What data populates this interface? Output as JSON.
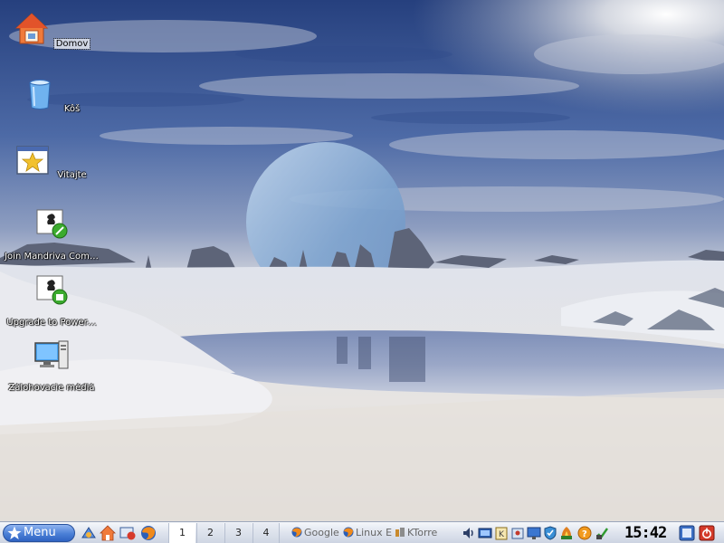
{
  "desktop": {
    "icons": [
      {
        "label": "Domov",
        "icon": "home-folder-icon",
        "selected": true
      },
      {
        "label": "Kôš",
        "icon": "trash-icon"
      },
      {
        "label": "Vitajte",
        "icon": "welcome-star-icon"
      },
      {
        "label": "Join Mandriva Com…",
        "icon": "join-mandriva-icon"
      },
      {
        "label": "Upgrade to Power…",
        "icon": "upgrade-powerpack-icon"
      },
      {
        "label": "Zálohovacie médiá",
        "icon": "backup-media-icon"
      }
    ]
  },
  "taskbar": {
    "menu_label": "Menu",
    "quick_launch": [
      "mandriva-control-center-icon",
      "home-icon",
      "konqueror-icon",
      "firefox-icon"
    ],
    "pager": {
      "desktops": [
        "1",
        "2",
        "3",
        "4"
      ],
      "active": "1"
    },
    "tasks": [
      {
        "label": "Google",
        "icon": "firefox-icon"
      },
      {
        "label": "Linux E",
        "icon": "firefox-icon"
      },
      {
        "label": "KTorre",
        "icon": "ktorrent-icon"
      }
    ],
    "tray": [
      "volume-icon",
      "network-icon",
      "klipper-icon",
      "kwallet-icon",
      "display-icon",
      "update-shield-icon",
      "firewall-icon",
      "help-icon",
      "tray-status-icon"
    ],
    "clock": "15:42",
    "end_buttons": [
      "show-desktop-icon",
      "power-icon"
    ]
  },
  "colors": {
    "taskbar_accent": "#4a7fd6",
    "selection": "#ffffff"
  }
}
